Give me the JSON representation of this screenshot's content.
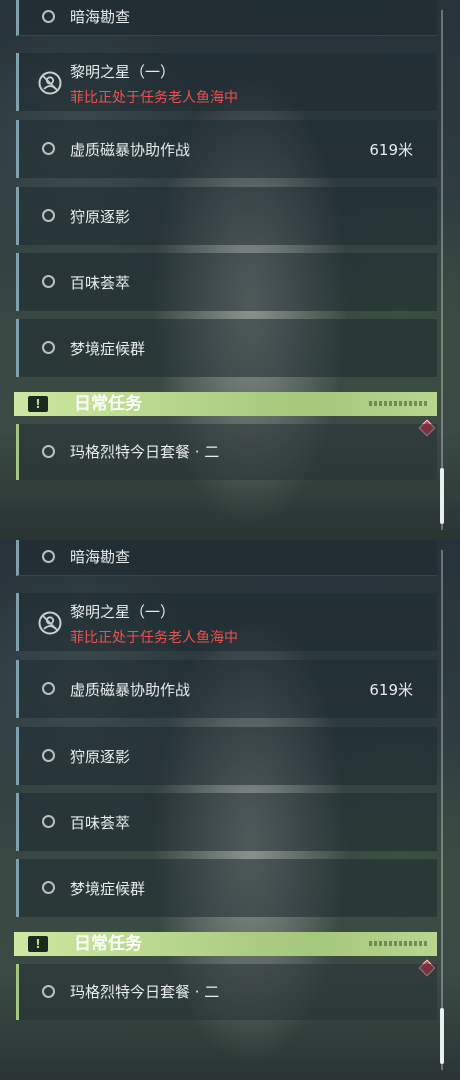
{
  "main_quests": [
    {
      "title": "暗海勘查"
    },
    {
      "title": "黎明之星（一）",
      "subtitle": "菲比正处于任务老人鱼海中",
      "tracked": true
    },
    {
      "title": "虚质磁暴协助作战",
      "distance": "619米"
    },
    {
      "title": "狩原逐影"
    },
    {
      "title": "百味荟萃"
    },
    {
      "title": "梦境症候群"
    }
  ],
  "daily_section": {
    "badge": "!",
    "label": "日常任务",
    "quests": [
      {
        "title": "玛格烈特今日套餐 · 二"
      }
    ]
  },
  "colors": {
    "accent_blue": "#7fa0ad",
    "daily_green": "#a6c77f",
    "alert_red": "#f0504f"
  },
  "icons": [
    "circle-icon",
    "tracked-quest-icon",
    "exclamation-icon",
    "red-gem-icon"
  ]
}
